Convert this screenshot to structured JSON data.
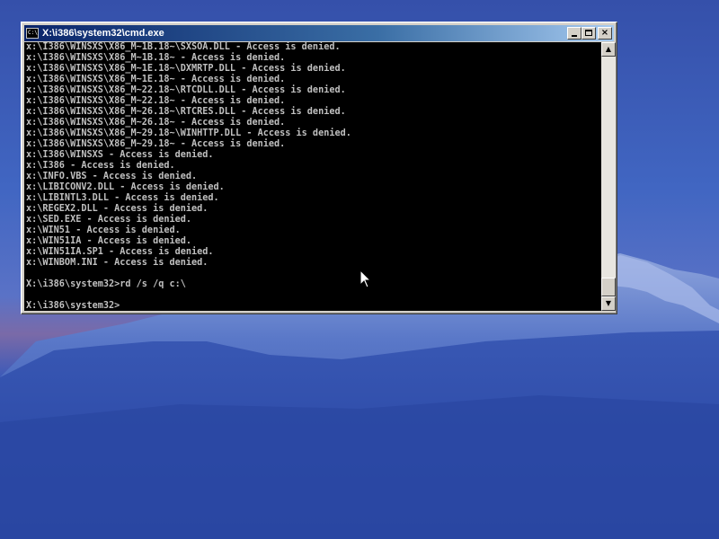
{
  "window": {
    "title": "X:\\i386\\system32\\cmd.exe",
    "icon_name": "console-icon",
    "icon_text": "C:\\",
    "buttons": {
      "minimize_icon": "minimize-icon",
      "maximize_icon": "maximize-icon",
      "close_icon": "close-icon",
      "close_glyph": "×"
    }
  },
  "console": {
    "lines": [
      "x:\\I386\\WINSXS\\X86_M~1B.18~\\SXSOA.DLL - Access is denied.",
      "x:\\I386\\WINSXS\\X86_M~1B.18~ - Access is denied.",
      "x:\\I386\\WINSXS\\X86_M~1E.18~\\DXMRTP.DLL - Access is denied.",
      "x:\\I386\\WINSXS\\X86_M~1E.18~ - Access is denied.",
      "x:\\I386\\WINSXS\\X86_M~22.18~\\RTCDLL.DLL - Access is denied.",
      "x:\\I386\\WINSXS\\X86_M~22.18~ - Access is denied.",
      "x:\\I386\\WINSXS\\X86_M~26.18~\\RTCRES.DLL - Access is denied.",
      "x:\\I386\\WINSXS\\X86_M~26.18~ - Access is denied.",
      "x:\\I386\\WINSXS\\X86_M~29.18~\\WINHTTP.DLL - Access is denied.",
      "x:\\I386\\WINSXS\\X86_M~29.18~ - Access is denied.",
      "x:\\I386\\WINSXS - Access is denied.",
      "x:\\I386 - Access is denied.",
      "x:\\INFO.VBS - Access is denied.",
      "x:\\LIBICONV2.DLL - Access is denied.",
      "x:\\LIBINTL3.DLL - Access is denied.",
      "x:\\REGEX2.DLL - Access is denied.",
      "x:\\SED.EXE - Access is denied.",
      "x:\\WIN51 - Access is denied.",
      "x:\\WIN51IA - Access is denied.",
      "x:\\WIN51IA.SP1 - Access is denied.",
      "x:\\WINBOM.INI - Access is denied.",
      "",
      "X:\\i386\\system32>rd /s /q c:\\",
      "",
      "X:\\i386\\system32>"
    ]
  },
  "scrollbar": {
    "up_glyph": "▲",
    "down_glyph": "▼",
    "up_icon": "scroll-up-arrow-icon",
    "down_icon": "scroll-down-arrow-icon"
  },
  "desktop": {
    "wallpaper": "mountain-wallpaper",
    "colors": {
      "sky": "#3a5cb8",
      "mountain": "#2a4aa6",
      "snow": "#9fb4e6",
      "title_bar_start": "#0a246a",
      "title_bar_end": "#a6caf0",
      "console_bg": "#000000",
      "console_text": "#c0c0c0"
    }
  }
}
